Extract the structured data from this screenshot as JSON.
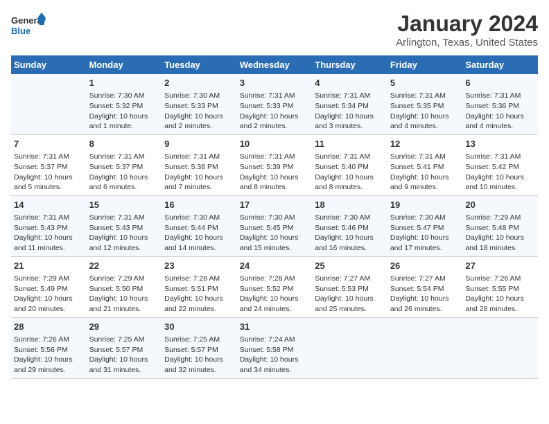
{
  "logo": {
    "text_general": "General",
    "text_blue": "Blue"
  },
  "title": "January 2024",
  "subtitle": "Arlington, Texas, United States",
  "header_days": [
    "Sunday",
    "Monday",
    "Tuesday",
    "Wednesday",
    "Thursday",
    "Friday",
    "Saturday"
  ],
  "weeks": [
    [
      {
        "day": "",
        "info": ""
      },
      {
        "day": "1",
        "info": "Sunrise: 7:30 AM\nSunset: 5:32 PM\nDaylight: 10 hours\nand 1 minute."
      },
      {
        "day": "2",
        "info": "Sunrise: 7:30 AM\nSunset: 5:33 PM\nDaylight: 10 hours\nand 2 minutes."
      },
      {
        "day": "3",
        "info": "Sunrise: 7:31 AM\nSunset: 5:33 PM\nDaylight: 10 hours\nand 2 minutes."
      },
      {
        "day": "4",
        "info": "Sunrise: 7:31 AM\nSunset: 5:34 PM\nDaylight: 10 hours\nand 3 minutes."
      },
      {
        "day": "5",
        "info": "Sunrise: 7:31 AM\nSunset: 5:35 PM\nDaylight: 10 hours\nand 4 minutes."
      },
      {
        "day": "6",
        "info": "Sunrise: 7:31 AM\nSunset: 5:36 PM\nDaylight: 10 hours\nand 4 minutes."
      }
    ],
    [
      {
        "day": "7",
        "info": "Sunrise: 7:31 AM\nSunset: 5:37 PM\nDaylight: 10 hours\nand 5 minutes."
      },
      {
        "day": "8",
        "info": "Sunrise: 7:31 AM\nSunset: 5:37 PM\nDaylight: 10 hours\nand 6 minutes."
      },
      {
        "day": "9",
        "info": "Sunrise: 7:31 AM\nSunset: 5:38 PM\nDaylight: 10 hours\nand 7 minutes."
      },
      {
        "day": "10",
        "info": "Sunrise: 7:31 AM\nSunset: 5:39 PM\nDaylight: 10 hours\nand 8 minutes."
      },
      {
        "day": "11",
        "info": "Sunrise: 7:31 AM\nSunset: 5:40 PM\nDaylight: 10 hours\nand 8 minutes."
      },
      {
        "day": "12",
        "info": "Sunrise: 7:31 AM\nSunset: 5:41 PM\nDaylight: 10 hours\nand 9 minutes."
      },
      {
        "day": "13",
        "info": "Sunrise: 7:31 AM\nSunset: 5:42 PM\nDaylight: 10 hours\nand 10 minutes."
      }
    ],
    [
      {
        "day": "14",
        "info": "Sunrise: 7:31 AM\nSunset: 5:43 PM\nDaylight: 10 hours\nand 11 minutes."
      },
      {
        "day": "15",
        "info": "Sunrise: 7:31 AM\nSunset: 5:43 PM\nDaylight: 10 hours\nand 12 minutes."
      },
      {
        "day": "16",
        "info": "Sunrise: 7:30 AM\nSunset: 5:44 PM\nDaylight: 10 hours\nand 14 minutes."
      },
      {
        "day": "17",
        "info": "Sunrise: 7:30 AM\nSunset: 5:45 PM\nDaylight: 10 hours\nand 15 minutes."
      },
      {
        "day": "18",
        "info": "Sunrise: 7:30 AM\nSunset: 5:46 PM\nDaylight: 10 hours\nand 16 minutes."
      },
      {
        "day": "19",
        "info": "Sunrise: 7:30 AM\nSunset: 5:47 PM\nDaylight: 10 hours\nand 17 minutes."
      },
      {
        "day": "20",
        "info": "Sunrise: 7:29 AM\nSunset: 5:48 PM\nDaylight: 10 hours\nand 18 minutes."
      }
    ],
    [
      {
        "day": "21",
        "info": "Sunrise: 7:29 AM\nSunset: 5:49 PM\nDaylight: 10 hours\nand 20 minutes."
      },
      {
        "day": "22",
        "info": "Sunrise: 7:29 AM\nSunset: 5:50 PM\nDaylight: 10 hours\nand 21 minutes."
      },
      {
        "day": "23",
        "info": "Sunrise: 7:28 AM\nSunset: 5:51 PM\nDaylight: 10 hours\nand 22 minutes."
      },
      {
        "day": "24",
        "info": "Sunrise: 7:28 AM\nSunset: 5:52 PM\nDaylight: 10 hours\nand 24 minutes."
      },
      {
        "day": "25",
        "info": "Sunrise: 7:27 AM\nSunset: 5:53 PM\nDaylight: 10 hours\nand 25 minutes."
      },
      {
        "day": "26",
        "info": "Sunrise: 7:27 AM\nSunset: 5:54 PM\nDaylight: 10 hours\nand 26 minutes."
      },
      {
        "day": "27",
        "info": "Sunrise: 7:26 AM\nSunset: 5:55 PM\nDaylight: 10 hours\nand 28 minutes."
      }
    ],
    [
      {
        "day": "28",
        "info": "Sunrise: 7:26 AM\nSunset: 5:56 PM\nDaylight: 10 hours\nand 29 minutes."
      },
      {
        "day": "29",
        "info": "Sunrise: 7:25 AM\nSunset: 5:57 PM\nDaylight: 10 hours\nand 31 minutes."
      },
      {
        "day": "30",
        "info": "Sunrise: 7:25 AM\nSunset: 5:57 PM\nDaylight: 10 hours\nand 32 minutes."
      },
      {
        "day": "31",
        "info": "Sunrise: 7:24 AM\nSunset: 5:58 PM\nDaylight: 10 hours\nand 34 minutes."
      },
      {
        "day": "",
        "info": ""
      },
      {
        "day": "",
        "info": ""
      },
      {
        "day": "",
        "info": ""
      }
    ]
  ],
  "colors": {
    "header_bg": "#2a6db5",
    "header_text": "#ffffff",
    "accent": "#1a6fb5"
  }
}
